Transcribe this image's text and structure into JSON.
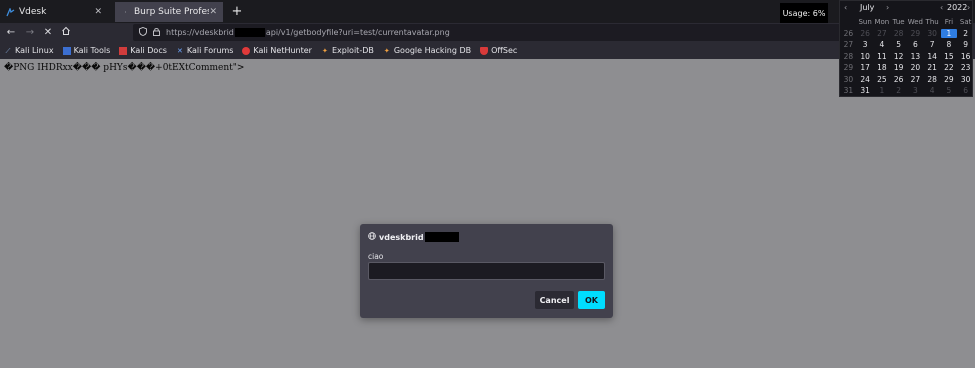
{
  "tabs": [
    {
      "label": "Vdesk",
      "icon": "kali-icon"
    },
    {
      "label": "Burp Suite Professional",
      "icon": "page-icon"
    }
  ],
  "usage": "Usage: 6%",
  "url": {
    "prefix": "https://vdeskbrid",
    "suffix": "api/v1/getbodyfile?uri=test/currentavatar.png"
  },
  "bookmarks": [
    {
      "label": "Kali Linux",
      "icon": "kali-icon"
    },
    {
      "label": "Kali Tools",
      "icon": "kali-tools-icon"
    },
    {
      "label": "Kali Docs",
      "icon": "kali-docs-icon"
    },
    {
      "label": "Kali Forums",
      "icon": "kali-forums-icon"
    },
    {
      "label": "Kali NetHunter",
      "icon": "nethunter-icon"
    },
    {
      "label": "Exploit-DB",
      "icon": "exploit-db-icon"
    },
    {
      "label": "Google Hacking DB",
      "icon": "ghdb-icon"
    },
    {
      "label": "OffSec",
      "icon": "offsec-icon"
    }
  ],
  "page": {
    "raw_text": "�PNG  IHDRxx��� pHYs���+0tEXtComment\">"
  },
  "calendar": {
    "month": "July",
    "year": "2022",
    "weekdays": [
      "Sun",
      "Mon",
      "Tue",
      "Wed",
      "Thu",
      "Fri",
      "Sat"
    ],
    "weeks": [
      {
        "wk": "26",
        "days": [
          "26",
          "27",
          "28",
          "29",
          "30",
          "1",
          "2"
        ]
      },
      {
        "wk": "27",
        "days": [
          "3",
          "4",
          "5",
          "6",
          "7",
          "8",
          "9"
        ]
      },
      {
        "wk": "28",
        "days": [
          "10",
          "11",
          "12",
          "13",
          "14",
          "15",
          "16"
        ]
      },
      {
        "wk": "29",
        "days": [
          "17",
          "18",
          "19",
          "20",
          "21",
          "22",
          "23"
        ]
      },
      {
        "wk": "30",
        "days": [
          "24",
          "25",
          "26",
          "27",
          "28",
          "29",
          "30"
        ]
      },
      {
        "wk": "31",
        "days": [
          "31",
          "1",
          "2",
          "3",
          "4",
          "5",
          "6"
        ]
      }
    ],
    "selected": "1"
  },
  "dialog": {
    "host": "vdeskbrid",
    "message": "ciao",
    "input_value": "",
    "cancel_label": "Cancel",
    "ok_label": "OK"
  },
  "colors": {
    "page_bg": "#8e8e91",
    "ok_button": "#00ddff",
    "dialog_bg": "#42414d",
    "toolbar_bg": "#2b2a33"
  }
}
